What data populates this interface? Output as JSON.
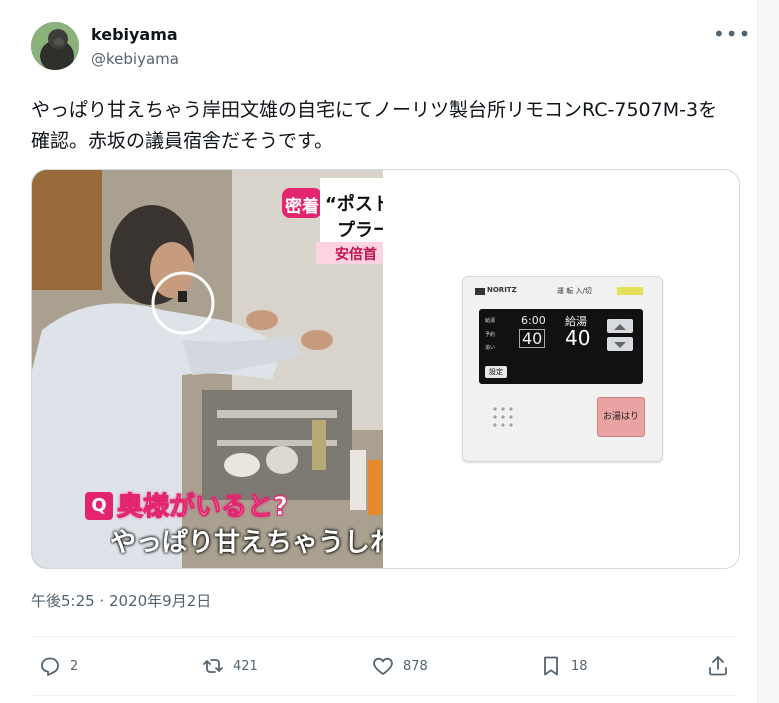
{
  "author": {
    "name": "kebiyama",
    "handle": "@kebiyama"
  },
  "tweet": {
    "text": "やっぱり甘えちゃう岸田文雄の自宅にてノーリツ製台所リモコンRC-7507M-3を確認。赤坂の議員宿舎だそうです。",
    "timestamp": "午後5:25 · 2020年9月2日"
  },
  "media": {
    "left_image": {
      "badge_mitchaku": "密着",
      "headline_1": "“ポスト",
      "headline_2": "プラー",
      "subhead": "安倍首",
      "q_badge": "Q",
      "caption_1": "奥様がいると?",
      "caption_2": "やっぱり甘えちゃうしれ"
    },
    "right_image": {
      "brand": "NORITZ",
      "run_label": "運 転 入/切",
      "time": "6:00",
      "kyuto_label": "給湯",
      "temp_left": "40",
      "temp_right": "40",
      "small_labels": [
        "給湯",
        "予約",
        "追い"
      ],
      "set_button": "設定",
      "ofuro_button": "お湯はり"
    }
  },
  "actions": {
    "reply_count": "2",
    "retweet_count": "421",
    "like_count": "878",
    "bookmark_count": "18"
  }
}
